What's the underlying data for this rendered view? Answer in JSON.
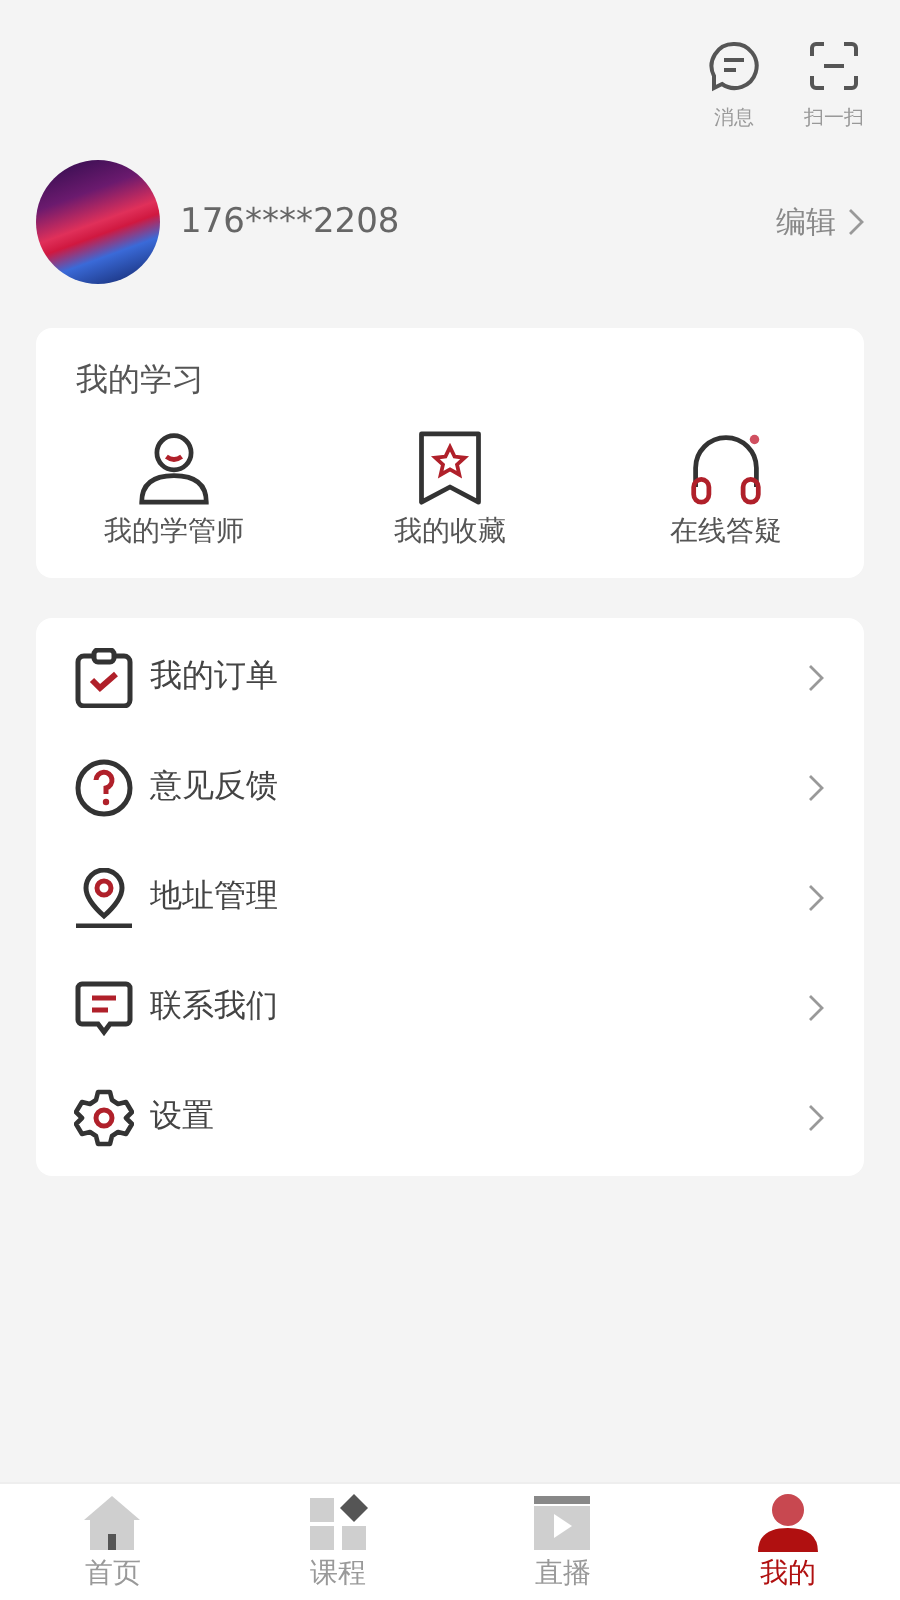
{
  "header_actions": [
    {
      "kind": "message",
      "label": "消息"
    },
    {
      "kind": "scan",
      "label": "扫一扫"
    }
  ],
  "profile": {
    "phone": "176****2208",
    "edit": "编辑"
  },
  "study": {
    "title": "我的学习",
    "items": [
      {
        "kind": "tutor",
        "label": "我的学管师"
      },
      {
        "kind": "favorites",
        "label": "我的收藏"
      },
      {
        "kind": "qa",
        "label": "在线答疑"
      }
    ]
  },
  "menu": [
    {
      "kind": "orders",
      "label": "我的订单"
    },
    {
      "kind": "feedback",
      "label": "意见反馈"
    },
    {
      "kind": "address",
      "label": "地址管理"
    },
    {
      "kind": "contact",
      "label": "联系我们"
    },
    {
      "kind": "settings",
      "label": "设置"
    }
  ],
  "tabs": [
    {
      "kind": "home",
      "label": "首页",
      "selected": false
    },
    {
      "kind": "courses",
      "label": "课程",
      "selected": false
    },
    {
      "kind": "live",
      "label": "直播",
      "selected": false
    },
    {
      "kind": "me",
      "label": "我的",
      "selected": true
    }
  ]
}
